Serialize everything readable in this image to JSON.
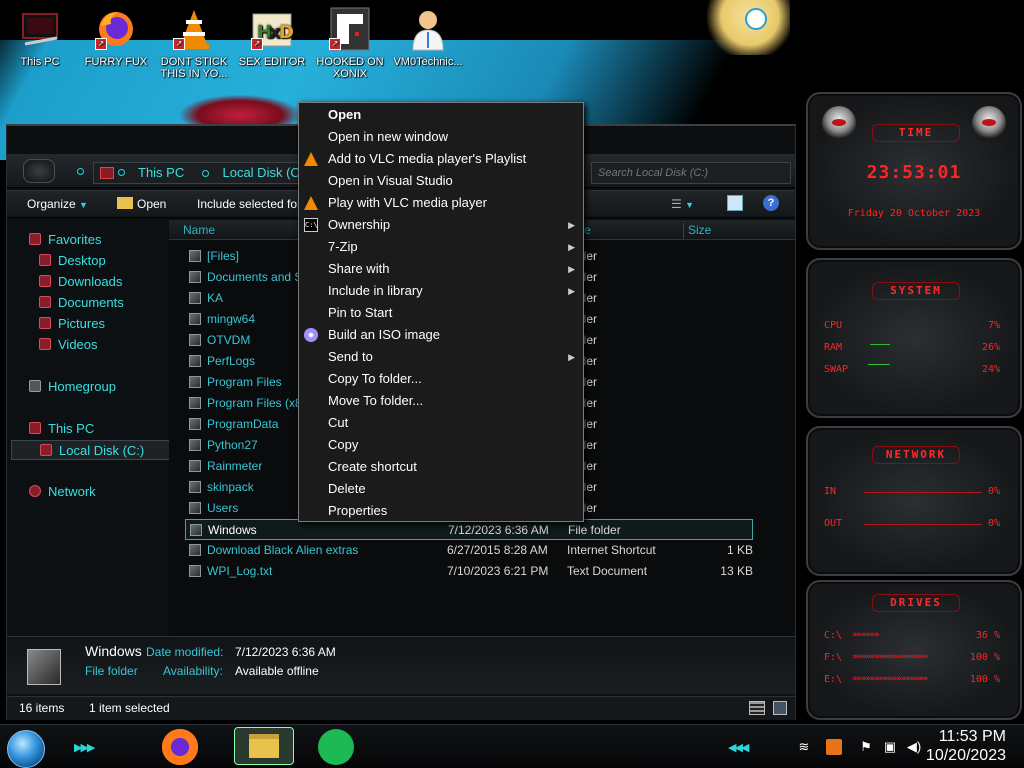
{
  "desktop_icons": [
    {
      "label": "This PC",
      "icon": "this-pc-icon"
    },
    {
      "label": "FURRY FUX",
      "icon": "firefox-icon"
    },
    {
      "label": "DONT STICK THIS IN YO...",
      "icon": "vlc-icon"
    },
    {
      "label": "SEX EDITOR",
      "icon": "hxd-editor-icon"
    },
    {
      "label": "HOOKED ON XONIX",
      "icon": "xonix-game-icon"
    },
    {
      "label": "VM0Technic...",
      "icon": "doctor-icon"
    }
  ],
  "explorer": {
    "address": {
      "segment1": "This PC",
      "segment2": "Local Disk (C:)"
    },
    "search_placeholder": "Search Local Disk (C:)",
    "toolbar": {
      "organize": "Organize",
      "open": "Open",
      "include": "Include selected fol"
    },
    "sidebar": [
      {
        "label": "Favorites",
        "group": true
      },
      {
        "label": "Desktop"
      },
      {
        "label": "Downloads"
      },
      {
        "label": "Documents"
      },
      {
        "label": "Pictures"
      },
      {
        "label": "Videos"
      },
      {
        "label": "Homegroup",
        "group": true
      },
      {
        "label": "This PC",
        "group": true
      },
      {
        "label": "Local Disk (C:)",
        "selected": true
      },
      {
        "label": "Network",
        "group": true
      }
    ],
    "columns": {
      "name": "Name",
      "type": "e",
      "size": "Size"
    },
    "files": [
      {
        "name": "[Files]",
        "date": "",
        "type": "folder",
        "size": ""
      },
      {
        "name": "Documents and Se",
        "date": "",
        "type": "folder",
        "size": ""
      },
      {
        "name": "KA",
        "date": "",
        "type": "folder",
        "size": ""
      },
      {
        "name": "mingw64",
        "date": "",
        "type": "folder",
        "size": ""
      },
      {
        "name": "OTVDM",
        "date": "",
        "type": "folder",
        "size": ""
      },
      {
        "name": "PerfLogs",
        "date": "",
        "type": "folder",
        "size": ""
      },
      {
        "name": "Program Files",
        "date": "",
        "type": "folder",
        "size": ""
      },
      {
        "name": "Program Files (x86",
        "date": "",
        "type": "folder",
        "size": ""
      },
      {
        "name": "ProgramData",
        "date": "",
        "type": "folder",
        "size": ""
      },
      {
        "name": "Python27",
        "date": "",
        "type": "folder",
        "size": ""
      },
      {
        "name": "Rainmeter",
        "date": "",
        "type": "folder",
        "size": ""
      },
      {
        "name": "skinpack",
        "date": "",
        "type": "folder",
        "size": ""
      },
      {
        "name": "Users",
        "date": "",
        "type": "folder",
        "size": ""
      },
      {
        "name": "Windows",
        "date": "7/12/2023 6:36 AM",
        "type": "File folder",
        "size": "",
        "selected": true
      },
      {
        "name": "Download Black Alien extras",
        "date": "6/27/2015 8:28 AM",
        "type": "Internet Shortcut",
        "size": "1 KB"
      },
      {
        "name": "WPI_Log.txt",
        "date": "7/10/2023 6:21 PM",
        "type": "Text Document",
        "size": "13 KB"
      }
    ],
    "details": {
      "name": "Windows",
      "type": "File folder",
      "modified_label": "Date modified:",
      "modified_value": "7/12/2023 6:36 AM",
      "availability_label": "Availability:",
      "availability_value": "Available offline"
    },
    "status": {
      "count": "16 items",
      "selected": "1 item selected"
    }
  },
  "context_menu": [
    {
      "label": "Open",
      "bold": true
    },
    {
      "label": "Open in new window"
    },
    {
      "label": "Add to VLC media player's Playlist",
      "icon": "vlc-icon"
    },
    {
      "label": "Open in Visual Studio"
    },
    {
      "label": "Play with VLC media player",
      "icon": "vlc-icon"
    },
    {
      "label": "Ownership",
      "icon": "cmd-icon",
      "submenu": true
    },
    {
      "label": "7-Zip",
      "submenu": true
    },
    {
      "label": "Share with",
      "submenu": true
    },
    {
      "label": "Include in library",
      "submenu": true
    },
    {
      "label": "Pin to Start"
    },
    {
      "label": "Build an ISO image",
      "icon": "disc-icon"
    },
    {
      "label": "Send to",
      "submenu": true
    },
    {
      "label": "Copy To folder..."
    },
    {
      "label": "Move To folder..."
    },
    {
      "label": "Cut"
    },
    {
      "label": "Copy"
    },
    {
      "label": "Create shortcut"
    },
    {
      "label": "Delete"
    },
    {
      "label": "Properties"
    }
  ],
  "widgets": {
    "time": {
      "title": "TIME",
      "clock": "23:53:01",
      "date": "Friday 20 October 2023"
    },
    "system": {
      "title": "SYSTEM",
      "rows": [
        {
          "label": "CPU",
          "value": "7%"
        },
        {
          "label": "RAM",
          "value": "26%"
        },
        {
          "label": "SWAP",
          "value": "24%"
        }
      ]
    },
    "network": {
      "title": "NETWORK",
      "rows": [
        {
          "label": "IN",
          "value": "0%"
        },
        {
          "label": "OUT",
          "value": "0%"
        }
      ]
    },
    "drives": {
      "title": "DRIVES",
      "rows": [
        {
          "label": "C:\\",
          "value": "36 %"
        },
        {
          "label": "F:\\",
          "value": "100 %"
        },
        {
          "label": "E:\\",
          "value": "100 %"
        }
      ]
    }
  },
  "taskbar": {
    "apps": [
      "firefox-icon",
      "file-explorer-icon",
      "spotify-icon"
    ],
    "time": "11:53 PM",
    "date": "10/20/2023"
  },
  "colors": {
    "accent": "#37e0e0",
    "widget_red": "#ff2424",
    "menu_bg": "#1b1b1b"
  }
}
